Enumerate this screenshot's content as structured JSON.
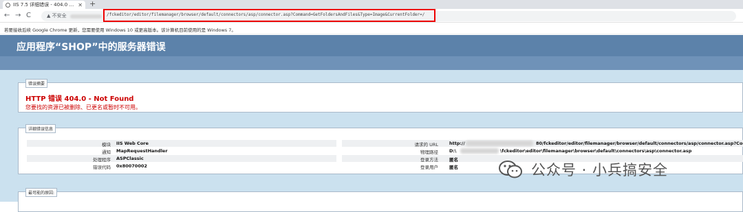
{
  "browser": {
    "tab_title": "IIS 7.5 详细错误 - 404.0 - N...",
    "new_tab": "+",
    "nav": {
      "back": "←",
      "forward": "→",
      "reload": "C"
    },
    "security_label": "不安全",
    "url": "/fckeditor/editor/filemanager/browser/default/connectors/asp/connector.asp?Command=GetFoldersAndFiles&Type=Image&CurrentFolder=/",
    "infobar": "若要接收后续 Google Chrome 更新，您需要使用 Windows 10 或更高版本。该计算机目前使用的是 Windows 7。",
    "url_highlight_color": "#e00000"
  },
  "page": {
    "title": "应用程序“SHOP”中的服务器错误",
    "summary": {
      "legend": "错误摘要",
      "heading": "HTTP 错误 404.0 - Not Found",
      "description": "您要找的资源已被删除、已更名或暂时不可用。"
    },
    "details": {
      "legend": "详细错误信息",
      "left": [
        {
          "label": "模块",
          "value": "IIS Web Core"
        },
        {
          "label": "通知",
          "value": "MapRequestHandler"
        },
        {
          "label": "处理程序",
          "value": "ASPClassic"
        },
        {
          "label": "错误代码",
          "value": "0x80070002"
        }
      ],
      "right": [
        {
          "label": "请求的 URL",
          "value_prefix": "http://",
          "value": "80/fckeditor/editor/filemanager/browser/default/connectors/asp/connector.asp?Comman"
        },
        {
          "label": "物理路径",
          "value_prefix": "D:\\",
          "value": "\\fckeditor\\editor\\filemanager\\browser\\default\\connectors\\asp\\connector.asp"
        },
        {
          "label": "登录方法",
          "value": "匿名"
        },
        {
          "label": "登录用户",
          "value": "匿名"
        }
      ]
    },
    "causes": {
      "legend": "最可能的原因:"
    },
    "colors": {
      "header_bg": "#5c82aa",
      "content_bg": "#cbe1ef",
      "error_red": "#cc0000"
    }
  },
  "watermark": {
    "text": "公众号 · 小兵搞安全",
    "icon": "wechat-icon"
  }
}
